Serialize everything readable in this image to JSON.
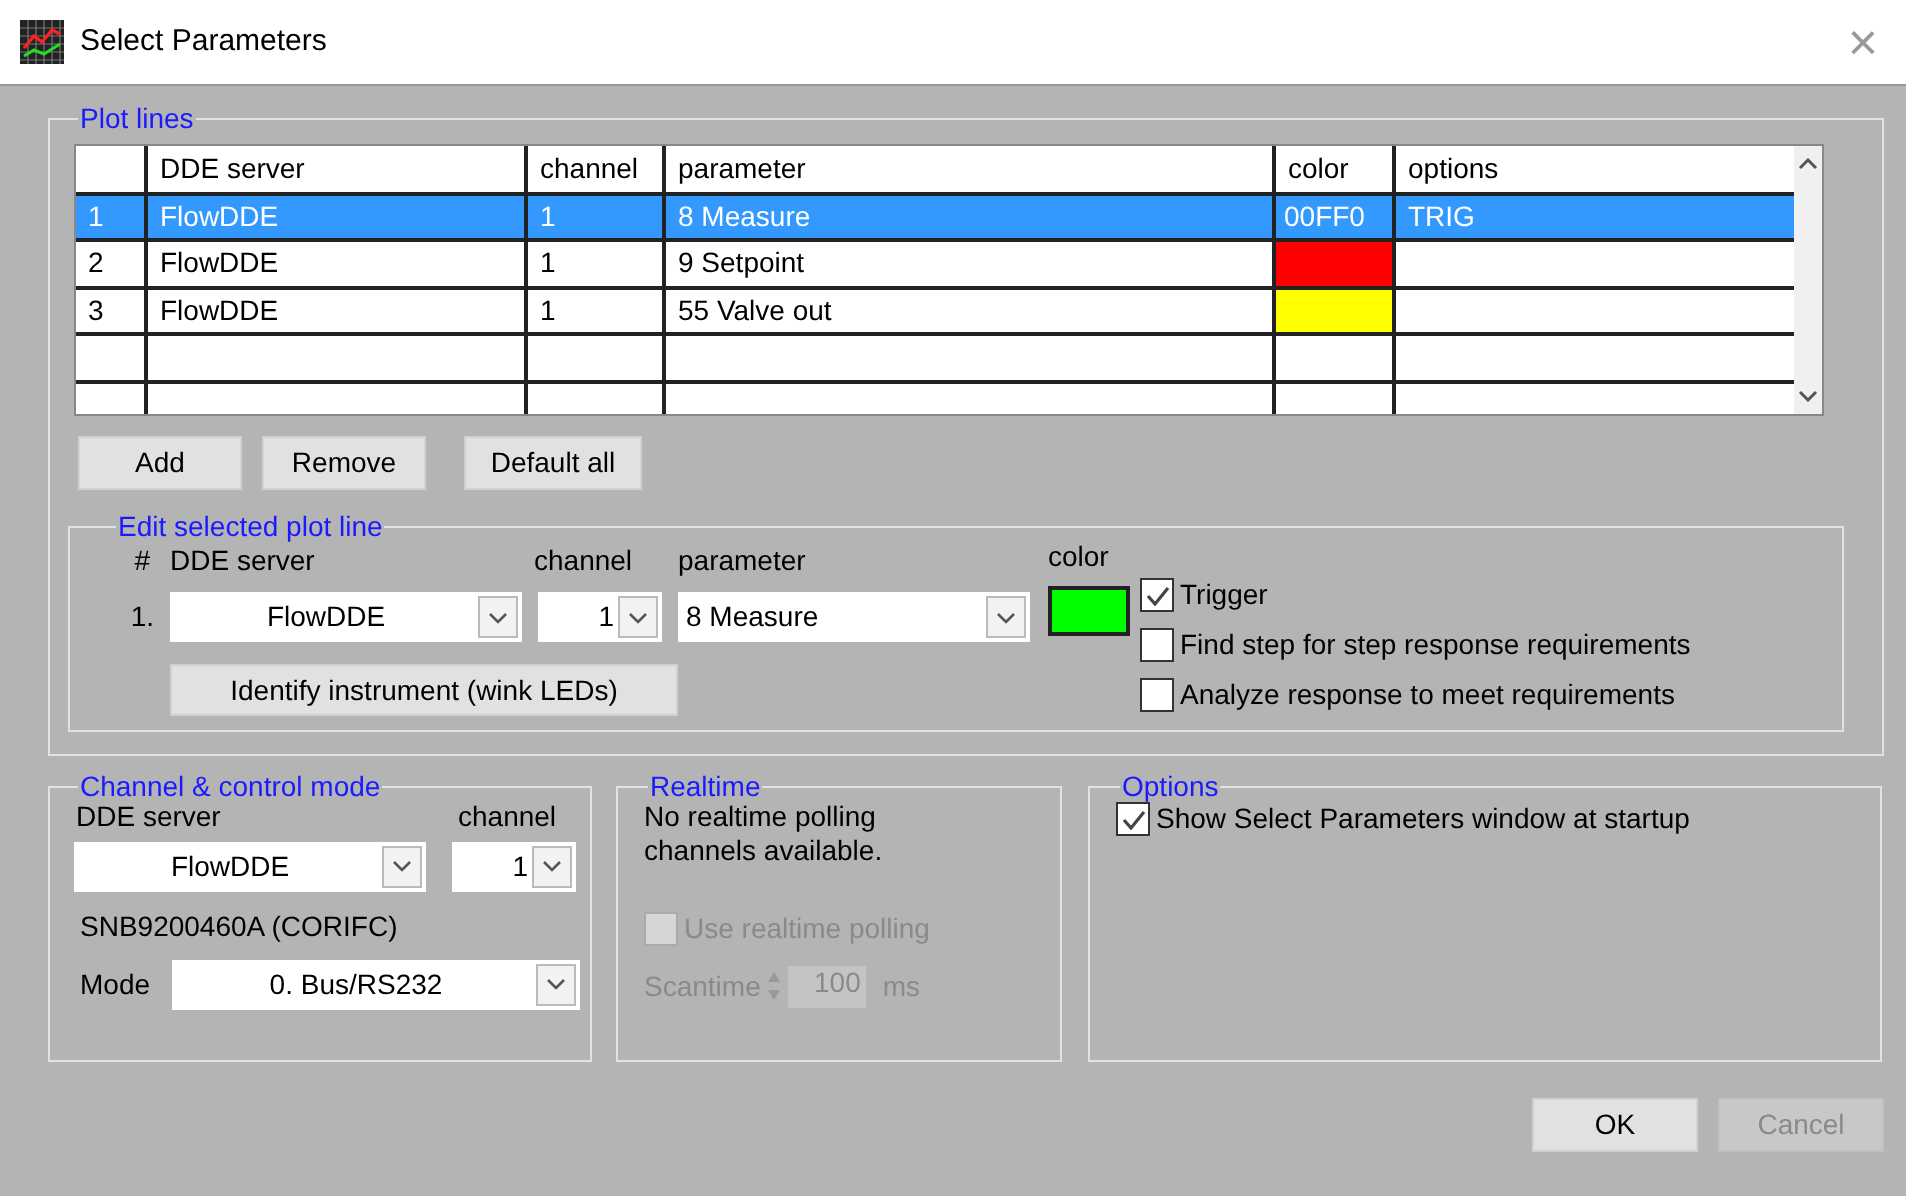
{
  "window": {
    "title": "Select Parameters",
    "close": "×"
  },
  "plot_lines": {
    "title": "Plot lines",
    "columns": [
      "",
      "DDE server",
      "channel",
      "parameter",
      "color",
      "options"
    ],
    "rows": [
      {
        "index": "1",
        "server": "FlowDDE",
        "channel": "1",
        "parameter": "8 Measure",
        "color_text": "00FF0",
        "options": "TRIG",
        "selected": true
      },
      {
        "index": "2",
        "server": "FlowDDE",
        "channel": "1",
        "parameter": "9 Setpoint",
        "color": "#ff0000",
        "selected": false
      },
      {
        "index": "3",
        "server": "FlowDDE",
        "channel": "1",
        "parameter": "55 Valve out",
        "color": "#ffff00",
        "selected": false
      }
    ],
    "buttons": [
      "Add",
      "Remove",
      "Default all"
    ]
  },
  "edit": {
    "title": "Edit selected plot line",
    "labels": {
      "index": "#",
      "server": "DDE server",
      "channel": "channel",
      "parameter": "parameter",
      "color_heading": "color"
    },
    "index": "1.",
    "server": "FlowDDE",
    "channel": "1",
    "parameter": "8 Measure",
    "color": "#00ff00",
    "identify_button": "Identify instrument (wink LEDs)",
    "checkboxes": [
      {
        "label": "Trigger",
        "checked": true
      },
      {
        "label": "Find step for step response requirements",
        "checked": false
      },
      {
        "label": "Analyze response to meet requirements",
        "checked": false
      }
    ]
  },
  "channel_mode": {
    "title": "Channel & control mode",
    "server_label": "DDE server",
    "channel_label": "channel",
    "server": "FlowDDE",
    "channel": "1",
    "instrument": "SNB9200460A (CORIFC)",
    "mode_label": "Mode",
    "mode": "0. Bus/RS232"
  },
  "realtime": {
    "title": "Realtime",
    "message": "No realtime polling channels available.",
    "use_polling": {
      "label": "Use realtime polling",
      "checked": false,
      "disabled": true
    },
    "scantime": {
      "label": "Scantime",
      "value": "100",
      "unit": "ms",
      "disabled": true
    }
  },
  "options": {
    "title": "Options",
    "checkboxes": [
      {
        "label": "Show Select Parameters window at startup",
        "checked": true
      }
    ]
  },
  "buttons": [
    {
      "label": "OK",
      "disabled": false
    },
    {
      "label": "Cancel",
      "disabled": true
    }
  ]
}
